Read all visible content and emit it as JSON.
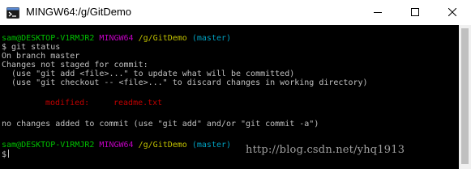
{
  "window": {
    "title": "MINGW64:/g/GitDemo",
    "icon": "mingw-terminal-icon",
    "controls": {
      "minimize": "minimize-icon",
      "maximize": "maximize-icon",
      "close": "close-icon"
    }
  },
  "terminal": {
    "prompt1": {
      "user_host": "sam@DESKTOP-V1RMJR2",
      "env": "MINGW64",
      "path": "/g/GitDemo",
      "branch": "(master)"
    },
    "command": "$ git status",
    "output": [
      "On branch master",
      "Changes not staged for commit:",
      "  (use \"git add <file>...\" to update what will be committed)",
      "  (use \"git checkout -- <file>...\" to discard changes in working directory)"
    ],
    "modified_label": "modified:",
    "modified_file": "readme.txt",
    "summary": "no changes added to commit (use \"git add\" and/or \"git commit -a\")",
    "prompt2": {
      "user_host": "sam@DESKTOP-V1RMJR2",
      "env": "MINGW64",
      "path": "/g/GitDemo",
      "branch": "(master)"
    },
    "input_prompt": "$"
  },
  "watermark": "http://blog.csdn.net/yhq1913",
  "colors": {
    "user_host": "#00c000",
    "env": "#c000c0",
    "path": "#c0c000",
    "branch": "#00a0c0",
    "modified": "#c00000",
    "text": "#c0c0c0",
    "background": "#000000"
  }
}
